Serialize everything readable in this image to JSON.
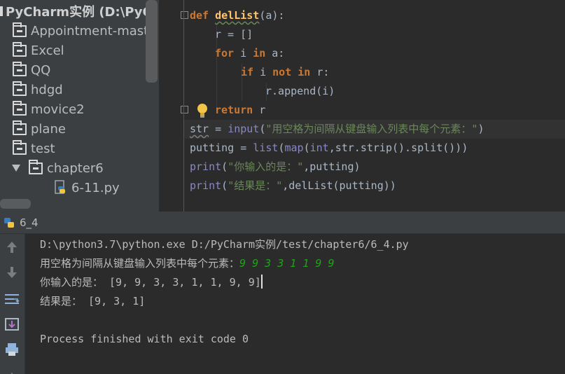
{
  "project_tree": {
    "root_label": "PyCharm实例 (D:\\PyCh",
    "items": [
      {
        "label": "Appointment-mast",
        "type": "folder"
      },
      {
        "label": "Excel",
        "type": "folder"
      },
      {
        "label": "QQ",
        "type": "folder"
      },
      {
        "label": "hdgd",
        "type": "folder"
      },
      {
        "label": "movice2",
        "type": "folder"
      },
      {
        "label": "plane",
        "type": "folder"
      },
      {
        "label": "test",
        "type": "folder"
      },
      {
        "label": "chapter6",
        "type": "folder",
        "expanded": true
      },
      {
        "label": "6-11.py",
        "type": "python-file"
      }
    ]
  },
  "editor": {
    "lines": [
      {
        "kw": "def",
        "fn": "delList",
        "rest": "(a):"
      },
      {
        "text": "r = []"
      },
      {
        "kw": "for",
        "var": " i ",
        "kw2": "in",
        "rest": " a:"
      },
      {
        "kw": "if",
        "var": " i ",
        "kw2": "not in",
        "rest": " r:"
      },
      {
        "text": "r.append(i)"
      },
      {
        "kw": "return",
        "rest": " r"
      },
      {
        "a": "str",
        "b": " = ",
        "bi": "input",
        "c": "(",
        "s": "\"用空格为间隔从键盘输入列表中每个元素：\"",
        "d": ")"
      },
      {
        "a": "putting = ",
        "bi1": "list",
        "b": "(",
        "bi2": "map",
        "c": "(",
        "bi3": "int",
        "d": ",str.strip().split()))"
      },
      {
        "bi": "print",
        "a": "(",
        "s": "\"你输入的是：\"",
        "b": ",putting)"
      },
      {
        "bi": "print",
        "a": "(",
        "s": "\"结果是：\"",
        "b": ",delList(putting))"
      }
    ]
  },
  "run_panel": {
    "tab_title": "6_4",
    "console_lines": {
      "command": "D:\\python3.7\\python.exe D:/PyCharm实例/test/chapter6/6_4.py",
      "prompt": "用空格为间隔从键盘输入列表中每个元素：",
      "user_input": "9 9 3 3 1 1 9 9",
      "echo": "你输入的是： [9, 9, 3, 3, 1, 1, 9, 9]",
      "result": "结果是： [9, 3, 1]",
      "exit": "Process finished with exit code 0"
    }
  },
  "colors": {
    "keyword": "#cc7832",
    "function": "#ffc66d",
    "builtin": "#8888c6",
    "string": "#6a8759",
    "text": "#a9b7c6",
    "user_input": "#21a11a"
  },
  "icons": {
    "toolbar": [
      "up-arrow-icon",
      "down-arrow-icon",
      "soft-wrap-icon",
      "scroll-to-end-icon",
      "print-icon"
    ]
  }
}
